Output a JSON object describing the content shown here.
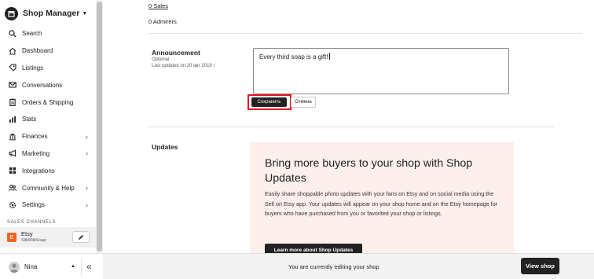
{
  "sidebar": {
    "title": "Shop Manager",
    "nav": [
      {
        "label": "Search",
        "icon": "search-icon"
      },
      {
        "label": "Dashboard",
        "icon": "home-icon"
      },
      {
        "label": "Listings",
        "icon": "listings-icon"
      },
      {
        "label": "Conversations",
        "icon": "mail-icon"
      },
      {
        "label": "Orders & Shipping",
        "icon": "clipboard-icon"
      },
      {
        "label": "Stats",
        "icon": "bar-chart-icon"
      },
      {
        "label": "Finances",
        "icon": "bank-icon"
      },
      {
        "label": "Marketing",
        "icon": "megaphone-icon"
      },
      {
        "label": "Integrations",
        "icon": "grid-icon"
      },
      {
        "label": "Community & Help",
        "icon": "people-icon"
      },
      {
        "label": "Settings",
        "icon": "gear-icon"
      }
    ],
    "channels_label": "SALES CHANNELS",
    "channel": {
      "badge": "E",
      "name": "Etsy",
      "sub": "SilkMilkSoap"
    },
    "user": {
      "name": "Nina"
    }
  },
  "main": {
    "sales_link": "0 Sales",
    "admirers": "0 Admirers",
    "announcement": {
      "title": "Announcement",
      "optional": "Optional",
      "last_updated": "Last updated on 20 авг 2019 г",
      "text": "Every third soap is a gift!",
      "save_label": "Сохранить",
      "cancel_label": "Отмена"
    },
    "updates": {
      "title": "Updates",
      "promo_heading": "Bring more buyers to your shop with Shop Updates",
      "promo_body": "Easily share shoppable photo updates with your fans on Etsy and on social media using the Sell on Etsy app. Your updates will appear on your shop home and on the Etsy homepage for buyers who have purchased from you or favorited your shop or listings.",
      "promo_button": "Learn more about Shop Updates"
    }
  },
  "bottom_bar": {
    "text": "You are currently editing your shop",
    "button": "View shop"
  },
  "colors": {
    "highlight": "#e8141c",
    "etsy_orange": "#f1641e",
    "promo_bg": "#fdf0ec"
  }
}
